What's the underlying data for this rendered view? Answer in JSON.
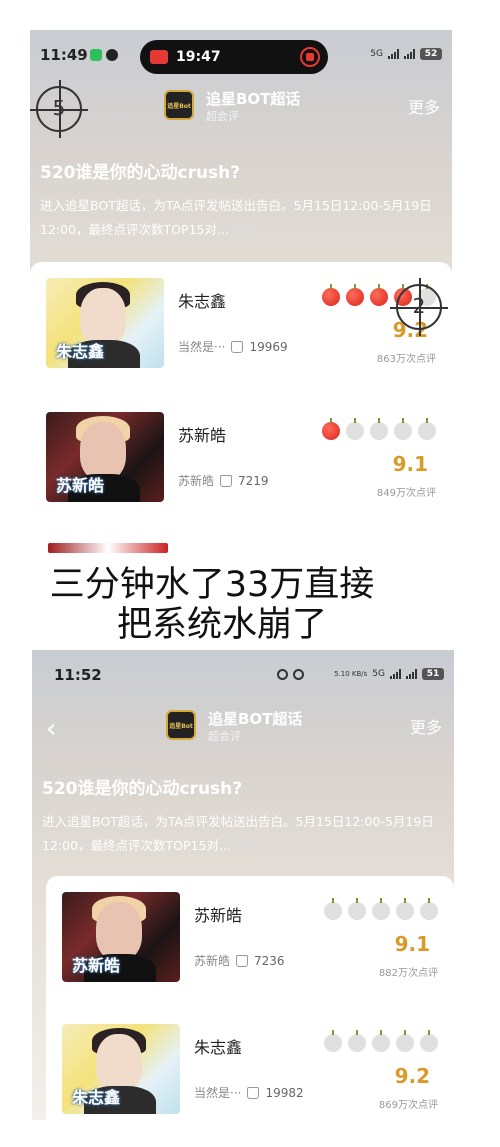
{
  "caption": {
    "line1": "三分钟水了33万直接",
    "line2": "把系统水崩了"
  },
  "screen1": {
    "status": {
      "time": "11:49",
      "record_time": "19:47",
      "network": "5G",
      "battery": "52"
    },
    "header": {
      "logo_text": "追星Bot",
      "title": "追星BOT超话",
      "subtitle": "超会评",
      "more": "更多"
    },
    "overlay_marker_left": "5",
    "overlay_marker_right": "2",
    "headline": "520谁是你的心动crush?",
    "description": "进入追星BOT超话，为TA点评发帖送出告白。5月15日12:00-5月19日12:00，最终点评次数TOP15对...",
    "more_link": "更多",
    "rows": [
      {
        "name": "朱志鑫",
        "caption": "朱志鑫",
        "tag": "当然是···",
        "likes": "19969",
        "score": "9.2",
        "reviews": "863万次点评",
        "apples_on": 4
      },
      {
        "name": "苏新皓",
        "caption": "苏新皓",
        "tag": "苏新皓",
        "likes": "7219",
        "score": "9.1",
        "reviews": "849万次点评",
        "apples_on": 1
      }
    ]
  },
  "screen2": {
    "status": {
      "time": "11:52",
      "speed": "5.10 KB/s",
      "network": "5G",
      "battery": "51"
    },
    "header": {
      "logo_text": "追星Bot",
      "title": "追星BOT超话",
      "subtitle": "超会评",
      "more": "更多",
      "back": "‹"
    },
    "headline": "520谁是你的心动crush?",
    "description": "进入追星BOT超话，为TA点评发帖送出告白。5月15日12:00-5月19日12:00，最终点评次数TOP15对...",
    "more_link": "更多",
    "rows": [
      {
        "name": "苏新皓",
        "caption": "苏新皓",
        "tag": "苏新皓",
        "likes": "7236",
        "score": "9.1",
        "reviews": "882万次点评",
        "apples_on": 0
      },
      {
        "name": "朱志鑫",
        "caption": "朱志鑫",
        "tag": "当然是···",
        "likes": "19982",
        "score": "9.2",
        "reviews": "869万次点评",
        "apples_on": 0
      }
    ]
  }
}
